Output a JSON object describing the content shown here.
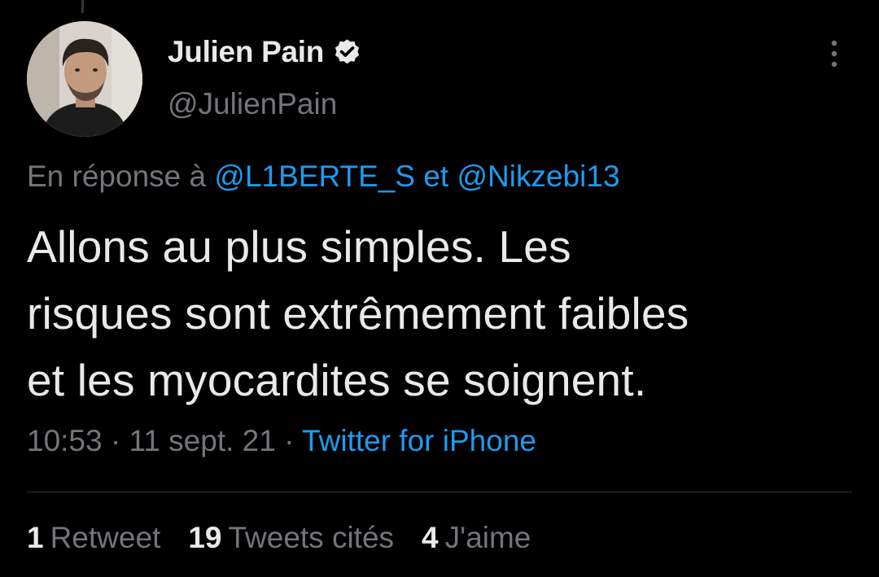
{
  "user": {
    "display_name": "Julien Pain",
    "handle": "@JulienPain",
    "verified": true,
    "avatar_icon": "profile-photo",
    "verified_icon": "verified-badge-icon",
    "menu_icon": "more-vertical-icon"
  },
  "reply": {
    "prefix": "En réponse à",
    "mention_1": "@L1BERTE_S",
    "joiner": "et",
    "mention_2": "@Nikzebi13"
  },
  "tweet": {
    "line_1": "Allons au plus simples. Les",
    "line_2": "risques sont extrêmement faibles",
    "line_3": "et les myocardites se soignent."
  },
  "meta": {
    "time": "10:53",
    "separator": "·",
    "date": "11 sept. 21",
    "source": "Twitter for iPhone"
  },
  "stats": {
    "retweets_count": "1",
    "retweets_label": "Retweet",
    "quotes_count": "19",
    "quotes_label": "Tweets cités",
    "likes_count": "4",
    "likes_label": "J'aime"
  },
  "colors": {
    "background": "#000000",
    "text": "#e7e9ea",
    "secondary": "#71767b",
    "accent": "#1d9bf0",
    "divider": "#2f3336"
  }
}
